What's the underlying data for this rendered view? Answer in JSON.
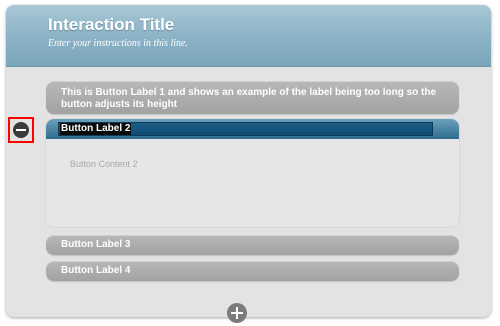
{
  "header": {
    "title": "Interaction Title",
    "instructions": "Enter your instructions in this line."
  },
  "accordion": {
    "items": [
      {
        "label": "This is Button Label 1 and shows an example of the label being too long so the button adjusts its height",
        "expanded": false
      },
      {
        "label": "Button Label 2",
        "expanded": true,
        "content": "Button Content 2"
      },
      {
        "label": "Button Label 3",
        "expanded": false
      },
      {
        "label": "Button Label 4",
        "expanded": false
      }
    ]
  },
  "controls": {
    "remove_icon": "minus-circle-icon",
    "add_icon": "plus-circle-icon",
    "highlight_color": "#ff0000"
  },
  "colors": {
    "header_blue": "#8fb5c8",
    "active_bar": "#0d4d76",
    "collapsed_bar": "#a2a2a2",
    "panel_bg": "#e3e3e3"
  }
}
